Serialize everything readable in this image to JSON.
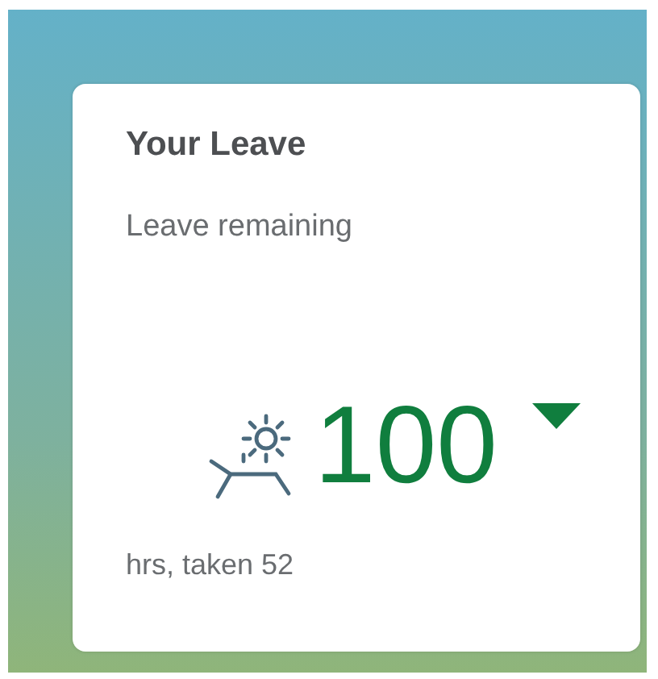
{
  "tile": {
    "title": "Your Leave",
    "subtitle": "Leave remaining",
    "kpi": {
      "value": "100",
      "positive": true,
      "trend_down": true
    },
    "footer": "hrs, taken 52"
  }
}
